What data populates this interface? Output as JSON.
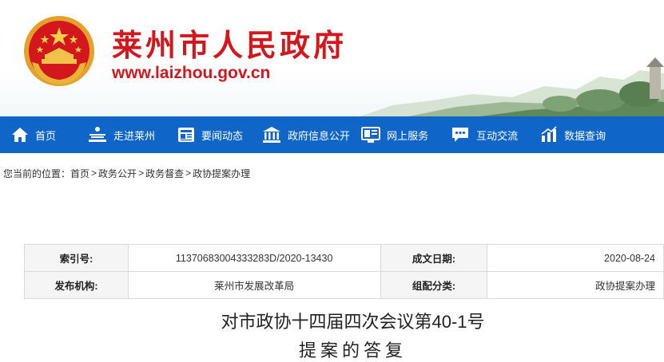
{
  "header": {
    "site_title": "莱州市人民政府",
    "site_url": "www.laizhou.gov.cn"
  },
  "nav": {
    "items": [
      {
        "label": "首页",
        "icon": "home-icon"
      },
      {
        "label": "走进莱州",
        "icon": "landmark-icon"
      },
      {
        "label": "要闻动态",
        "icon": "news-icon"
      },
      {
        "label": "政府信息公开",
        "icon": "government-building-icon"
      },
      {
        "label": "网上服务",
        "icon": "online-service-icon"
      },
      {
        "label": "互动交流",
        "icon": "chat-icon"
      },
      {
        "label": "数据查询",
        "icon": "bar-chart-icon"
      }
    ]
  },
  "breadcrumb": {
    "prefix": "您当前的位置：",
    "items": [
      "首页",
      "政务公开",
      "政务督查",
      "政协提案办理"
    ],
    "separator": ">"
  },
  "info": {
    "index_label": "索引号:",
    "index_value": "11370683004333283D/2020-13430",
    "date_label": "成文日期:",
    "date_value": "2020-08-24",
    "publisher_label": "发布机构:",
    "publisher_value": "莱州市发展改革局",
    "category_label": "组配分类:",
    "category_value": "政协提案办理"
  },
  "article": {
    "title_line1": "对市政协十四届四次会议第40-1号",
    "title_line2": "提案的答复"
  },
  "colors": {
    "brand_red": "#d4171c",
    "nav_blue": "#0f65c8"
  }
}
